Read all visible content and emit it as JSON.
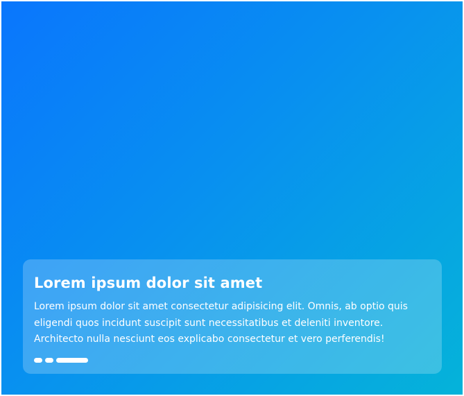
{
  "card": {
    "title": "Lorem ipsum dolor sit amet",
    "text": "Lorem ipsum dolor sit amet consectetur adipisicing elit. Omnis, ab optio quis eligendi quos incidunt suscipit sunt necessitatibus et deleniti inventore. Architecto nulla nesciunt eos explicabo consectetur et vero perferendis!"
  },
  "pagination": {
    "count": 3,
    "active_index": 2
  },
  "colors": {
    "gradient_start": "#0a76fd",
    "gradient_end": "#05b3d9",
    "card_overlay": "rgba(255,255,255,0.22)",
    "text": "#ffffff"
  }
}
